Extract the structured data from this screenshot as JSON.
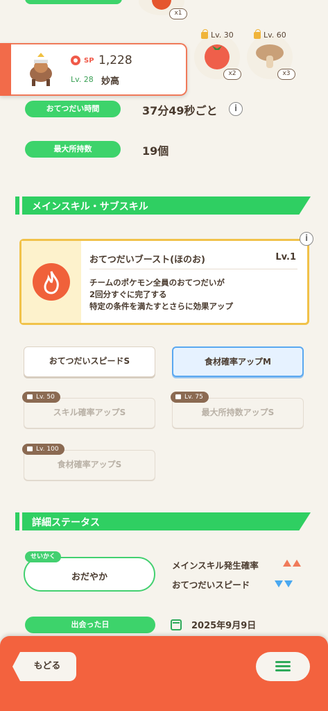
{
  "top_ingredients": [
    {
      "count": "x1"
    },
    {
      "level": "Lv. 30",
      "count": "x2"
    },
    {
      "level": "Lv. 60",
      "count": "x3"
    }
  ],
  "pokemon": {
    "sp_label": "SP",
    "sp_value": "1,228",
    "level": "Lv. 28",
    "name": "妙高"
  },
  "info_rows": [
    {
      "label": "おてつだい時間",
      "value": "37分49秒ごと"
    },
    {
      "label": "最大所持数",
      "value": "19個"
    }
  ],
  "section_skills": {
    "title": "メインスキル・サブスキル"
  },
  "main_skill": {
    "name": "おてつだいブースト(ほのお)",
    "level": "Lv.1",
    "description": [
      "チームのポケモン全員のおてつだいが",
      "2回分すぐに完了する",
      "特定の条件を満たすとさらに効果アップ"
    ]
  },
  "sub_skills": [
    {
      "label": "おてつだいスピードS"
    },
    {
      "label": "食材確率アップM"
    },
    {
      "label": "スキル確率アップS",
      "unlock": "Lv. 50"
    },
    {
      "label": "最大所持数アップS",
      "unlock": "Lv. 75"
    },
    {
      "label": "食材確率アップS",
      "unlock": "Lv. 100"
    }
  ],
  "section_status": {
    "title": "詳細ステータス"
  },
  "nature": {
    "tag": "せいかく",
    "value": "おだやか"
  },
  "nature_effects": [
    {
      "label": "メインスキル発生確率",
      "direction": "up"
    },
    {
      "label": "おてつだいスピード",
      "direction": "down"
    }
  ],
  "met_date": {
    "label": "出会った日",
    "value": "2025年9月9日"
  },
  "nav": {
    "back": "もどる"
  },
  "colors": {
    "accent_green": "#3dd36b",
    "bottom_bar": "#f3623e",
    "skill_border": "#f1c24a"
  }
}
